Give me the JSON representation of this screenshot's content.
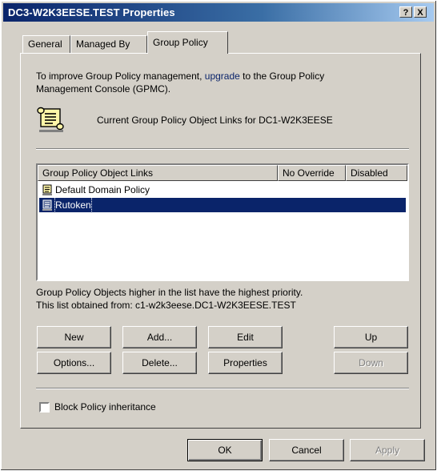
{
  "window": {
    "title": "DC3-W2K3EESE.TEST Properties",
    "help_label": "?",
    "close_label": "X"
  },
  "tabs": [
    {
      "label": "General"
    },
    {
      "label": "Managed By"
    },
    {
      "label": "Group Policy"
    }
  ],
  "group_policy": {
    "intro_part1": "To improve Group Policy management,",
    "intro_link": "upgrade",
    "intro_part2": "to the Group Policy",
    "intro_line2": "Management Console (GPMC).",
    "current_links_prefix": "Current Group Policy Object Links for",
    "current_links_domain": "DC1-W2K3EESE",
    "list": {
      "headers": [
        "Group Policy Object Links",
        "No Override",
        "Disabled"
      ],
      "rows": [
        {
          "name": "Default Domain Policy",
          "selected": false
        },
        {
          "name": "Rutoken",
          "selected": true
        }
      ]
    },
    "priority_note": "Group Policy Objects higher in the list have the highest priority.",
    "obtained_from": "This list obtained from: c1-w2k3eese.DC1-W2K3EESE.TEST",
    "buttons": {
      "new": "New",
      "add": "Add...",
      "edit": "Edit",
      "up": "Up",
      "options": "Options...",
      "delete": "Delete...",
      "properties": "Properties",
      "down": "Down"
    },
    "block_inheritance": {
      "label": "Block Policy inheritance",
      "checked": false
    }
  },
  "footer": {
    "ok": "OK",
    "cancel": "Cancel",
    "apply": "Apply"
  },
  "colors": {
    "title_gradient_start": "#0a246a",
    "selection": "#0a246a",
    "face": "#d4d0c8"
  }
}
